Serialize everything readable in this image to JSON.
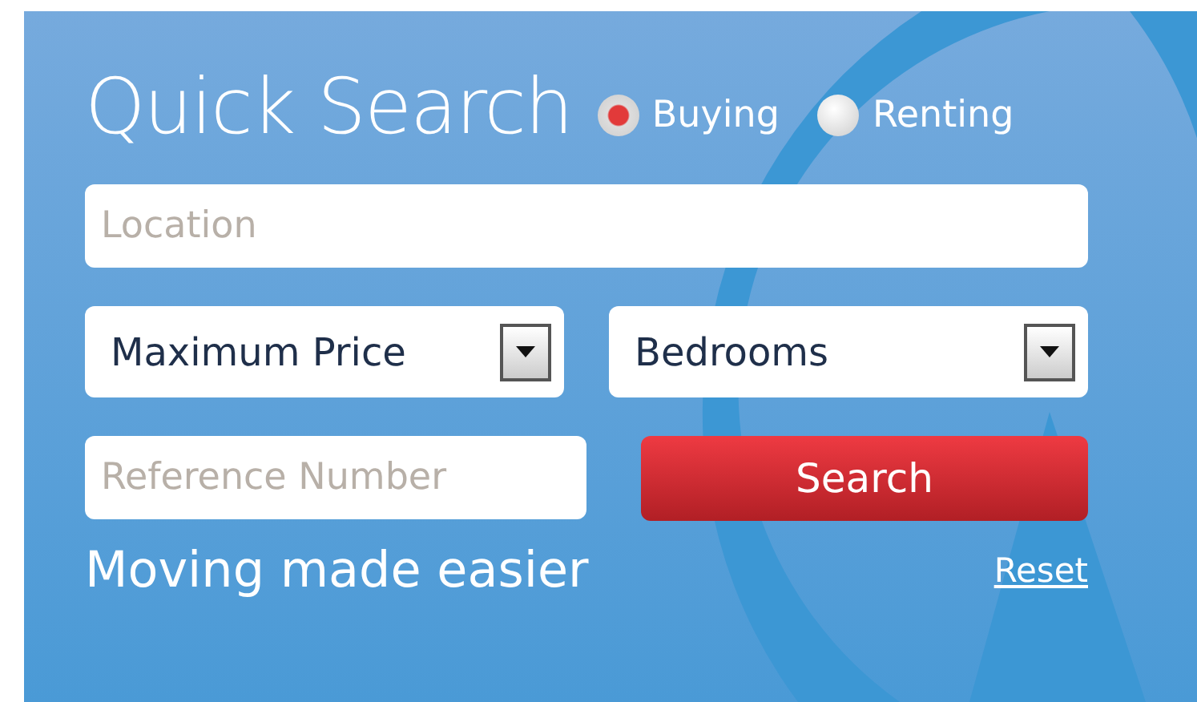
{
  "title": "Quick Search",
  "modes": [
    {
      "label": "Buying",
      "selected": true
    },
    {
      "label": "Renting",
      "selected": false
    }
  ],
  "location": {
    "placeholder": "Location"
  },
  "selects": [
    {
      "value": "Maximum Price"
    },
    {
      "value": "Bedrooms"
    }
  ],
  "reference": {
    "placeholder": "Reference Number"
  },
  "search_button": "Search",
  "tagline": "Moving made easier",
  "reset_link": "Reset"
}
